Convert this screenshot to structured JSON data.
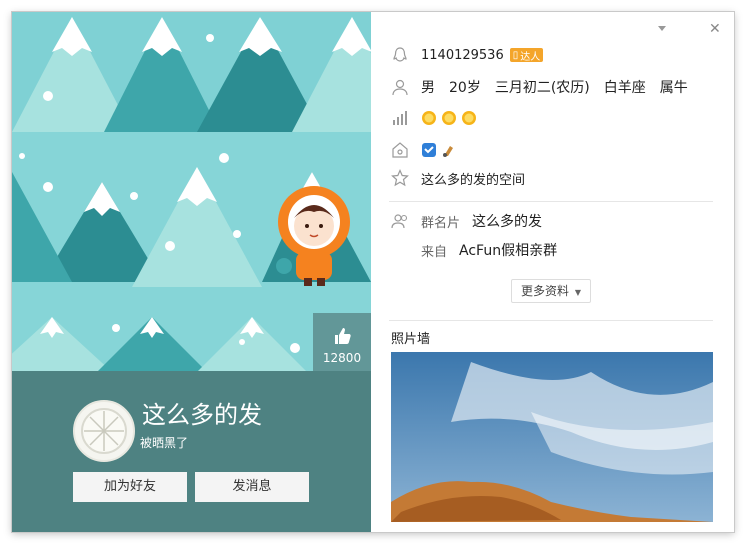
{
  "window": {
    "dropdown_icon": "chevron-down-icon",
    "close_label": "✕"
  },
  "cover": {
    "like_count": "12800"
  },
  "profile": {
    "nickname": "这么多的发",
    "status": "被晒黑了",
    "add_friend_label": "加为好友",
    "send_message_label": "发消息"
  },
  "info": {
    "qq_number": "1140129536",
    "talent_badge": "达人",
    "gender": "男",
    "age": "20岁",
    "birthday": "三月初二(农历)",
    "constellation": "白羊座",
    "zodiac": "属牛",
    "space_name": "这么多的发的空间",
    "group_card_label": "群名片",
    "group_card_value": "这么多的发",
    "from_label": "来自",
    "from_value": "AcFun假相亲群",
    "more_info_label": "更多资料",
    "photo_wall_title": "照片墙"
  },
  "colors": {
    "profile_bg": "#4e8282",
    "sky": "#7fd1d4",
    "badge_orange": "#f4a52a"
  }
}
